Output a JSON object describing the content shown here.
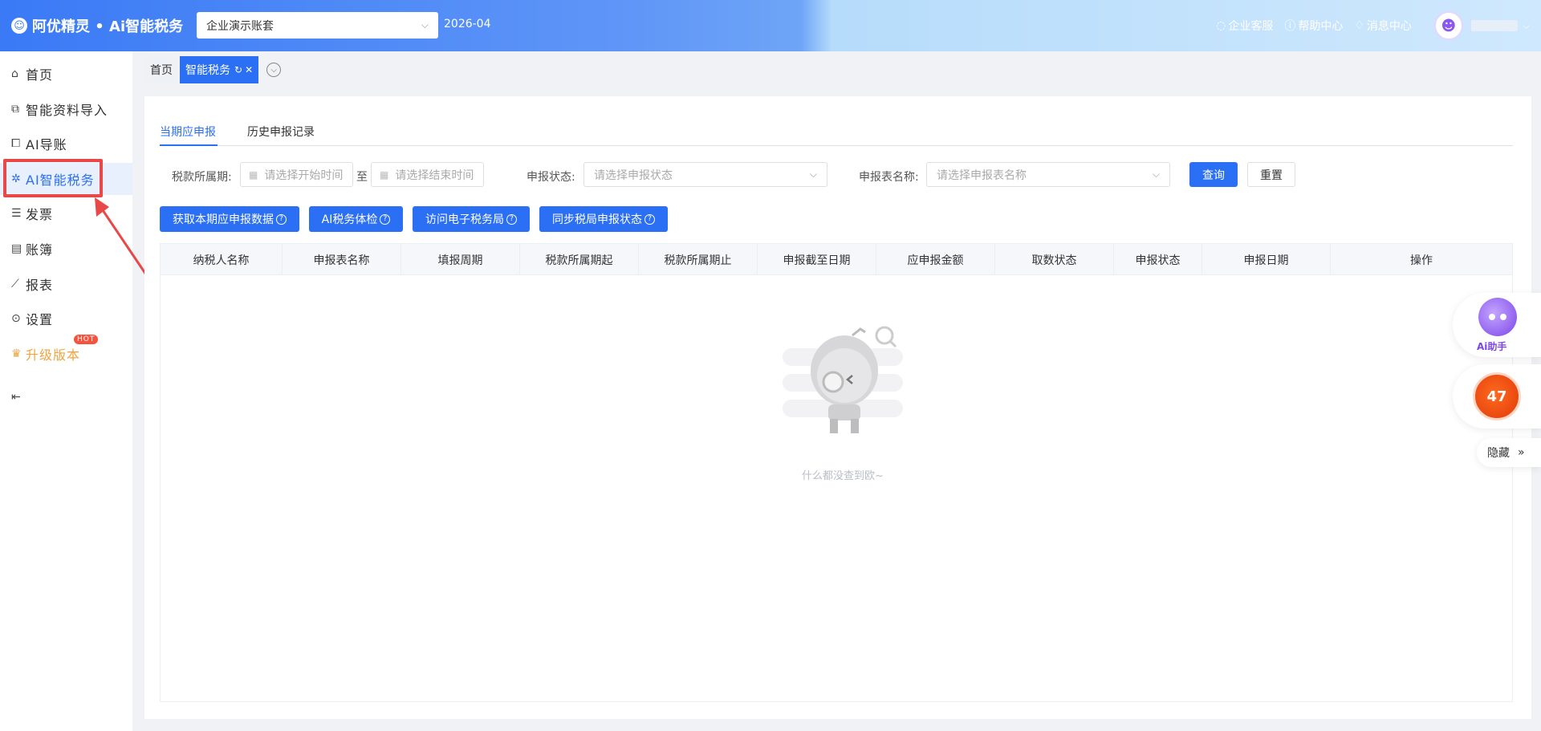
{
  "header": {
    "logo_text": "阿优精灵 • Ai智能税务",
    "account": "企业演示账套",
    "period": "2026-04",
    "links": [
      "企业客服",
      "帮助中心",
      "消息中心"
    ]
  },
  "sidebar": {
    "items": [
      {
        "label": "首页",
        "icon": "home-icon"
      },
      {
        "label": "智能资料导入",
        "icon": "import-icon"
      },
      {
        "label": "AI导账",
        "icon": "transfer-icon"
      },
      {
        "label": "AI智能税务",
        "icon": "gear-icon"
      },
      {
        "label": "发票",
        "icon": "invoice-icon"
      },
      {
        "label": "账簿",
        "icon": "ledger-icon"
      },
      {
        "label": "报表",
        "icon": "chart-icon"
      },
      {
        "label": "设置",
        "icon": "settings-icon"
      },
      {
        "label": "升级版本",
        "icon": "crown-icon"
      }
    ],
    "hot_badge": "HOT",
    "active_index": 3
  },
  "tabs": [
    {
      "label": "首页"
    },
    {
      "label": "智能税务"
    }
  ],
  "subtabs": [
    "当期应申报",
    "历史申报记录"
  ],
  "filters": {
    "period_label": "税款所属期:",
    "start_placeholder": "请选择开始时间",
    "to": "至",
    "end_placeholder": "请选择结束时间",
    "status_label": "申报状态:",
    "status_placeholder": "请选择申报状态",
    "form_label": "申报表名称:",
    "form_placeholder": "请选择申报表名称",
    "query": "查询",
    "reset": "重置"
  },
  "actions": [
    "获取本期应申报数据",
    "AI税务体检",
    "访问电子税务局",
    "同步税局申报状态"
  ],
  "table": {
    "columns": [
      "纳税人名称",
      "申报表名称",
      "填报周期",
      "税款所属期起",
      "税款所属期止",
      "申报截至日期",
      "应申报金额",
      "取数状态",
      "申报状态",
      "申报日期",
      "操作"
    ],
    "empty_text": "什么都没查到欧~"
  },
  "floating": {
    "ai_label": "Ai助手",
    "count": "47",
    "hide": "隐藏"
  },
  "colors": {
    "primary": "#2b6ff5",
    "highlight": "#e94848",
    "badge": "#f5533d"
  }
}
